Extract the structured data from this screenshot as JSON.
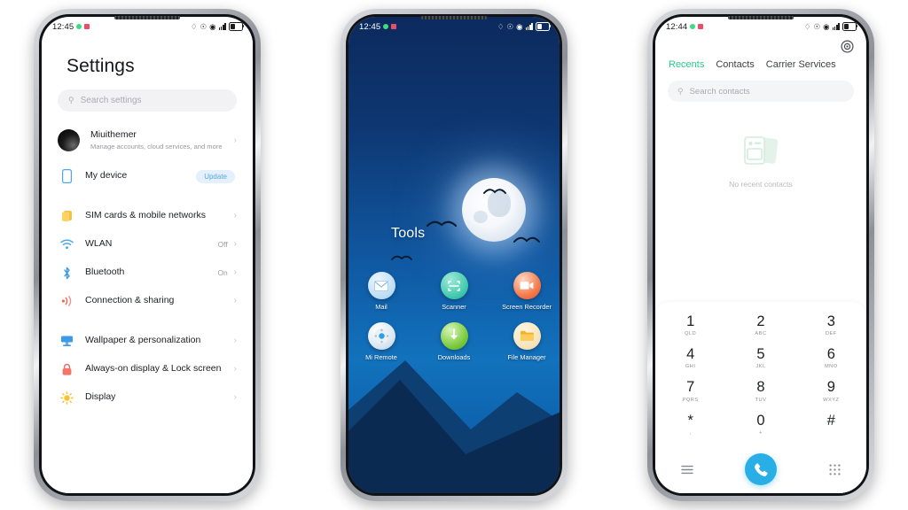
{
  "theme": {
    "accent_green": "#2cc98a",
    "accent_blue": "#29aee6",
    "badge_bg": "#e4f0fb",
    "badge_text": "#5aa7e0",
    "wallpaper_top": "#0c2a5e",
    "wallpaper_mid": "#1059a3",
    "mountain": "#0b2a52"
  },
  "phone1": {
    "name": "settings-screen",
    "statusbar": {
      "time": "12:45",
      "left_icons": [
        "phone-call-icon",
        "notification-icon"
      ],
      "right_icons": [
        "bluetooth-icon",
        "alarm-off-icon",
        "location-icon",
        "signal-icon",
        "battery-icon"
      ]
    },
    "title": "Settings",
    "search": {
      "placeholder": "Search settings",
      "icon": "search-icon"
    },
    "account": {
      "name": "Miuithemer",
      "subtitle": "Manage accounts, cloud services, and more",
      "avatar": "user-avatar",
      "chevron": "›"
    },
    "groups": [
      {
        "rows": [
          {
            "icon": "device-icon",
            "label": "My device",
            "value": "",
            "badge": "Update",
            "chevron": ""
          }
        ]
      },
      {
        "rows": [
          {
            "icon": "sim-card-icon",
            "label": "SIM cards & mobile networks",
            "value": "",
            "badge": "",
            "chevron": "›"
          },
          {
            "icon": "wifi-icon",
            "label": "WLAN",
            "value": "Off",
            "badge": "",
            "chevron": "›"
          },
          {
            "icon": "bluetooth-icon",
            "label": "Bluetooth",
            "value": "On",
            "badge": "",
            "chevron": "›"
          },
          {
            "icon": "connection-sharing-icon",
            "label": "Connection & sharing",
            "value": "",
            "badge": "",
            "chevron": "›"
          }
        ]
      },
      {
        "rows": [
          {
            "icon": "wallpaper-icon",
            "label": "Wallpaper & personalization",
            "value": "",
            "badge": "",
            "chevron": "›"
          },
          {
            "icon": "lock-icon",
            "label": "Always-on display & Lock screen",
            "value": "",
            "badge": "",
            "chevron": "›"
          },
          {
            "icon": "display-brightness-icon",
            "label": "Display",
            "value": "",
            "badge": "",
            "chevron": "›"
          }
        ]
      }
    ]
  },
  "phone2": {
    "name": "home-screen",
    "statusbar": {
      "time": "12:45",
      "left_icons": [
        "phone-call-icon",
        "notification-icon"
      ],
      "right_icons": [
        "bluetooth-icon",
        "alarm-off-icon",
        "location-icon",
        "signal-icon",
        "battery-icon"
      ]
    },
    "folder_label": "Tools",
    "apps": [
      [
        {
          "name": "Mail",
          "icon": "mail-icon"
        },
        {
          "name": "Scanner",
          "icon": "scanner-icon"
        },
        {
          "name": "Screen Recorder",
          "icon": "screen-recorder-icon"
        }
      ],
      [
        {
          "name": "Mi Remote",
          "icon": "remote-control-icon"
        },
        {
          "name": "Downloads",
          "icon": "download-icon"
        },
        {
          "name": "File Manager",
          "icon": "folder-icon"
        }
      ]
    ]
  },
  "phone3": {
    "name": "dialer-screen",
    "statusbar": {
      "time": "12:44",
      "left_icons": [
        "phone-call-icon",
        "notification-icon"
      ],
      "right_icons": [
        "bluetooth-icon",
        "alarm-off-icon",
        "location-icon",
        "signal-icon",
        "battery-icon"
      ]
    },
    "settings_icon": "gear-icon",
    "tabs": [
      {
        "label": "Recents",
        "active": true
      },
      {
        "label": "Contacts",
        "active": false
      },
      {
        "label": "Carrier Services",
        "active": false
      }
    ],
    "search": {
      "placeholder": "Search contacts",
      "icon": "search-icon"
    },
    "empty_state": {
      "icon": "no-contacts-icon",
      "text": "No recent contacts"
    },
    "keypad": [
      [
        {
          "num": "1",
          "sub": "QLD"
        },
        {
          "num": "2",
          "sub": "ABC"
        },
        {
          "num": "3",
          "sub": "DEF"
        }
      ],
      [
        {
          "num": "4",
          "sub": "GHI"
        },
        {
          "num": "5",
          "sub": "JKL"
        },
        {
          "num": "6",
          "sub": "MNO"
        }
      ],
      [
        {
          "num": "7",
          "sub": "PQRS"
        },
        {
          "num": "8",
          "sub": "TUV"
        },
        {
          "num": "9",
          "sub": "WXYZ"
        }
      ],
      [
        {
          "num": "*",
          "sub": ","
        },
        {
          "num": "0",
          "sub": "+"
        },
        {
          "num": "#",
          "sub": ""
        }
      ]
    ],
    "callbar": {
      "menu_icon": "menu-icon",
      "call_icon": "phone-call-icon",
      "keypad_icon": "keypad-icon"
    }
  }
}
